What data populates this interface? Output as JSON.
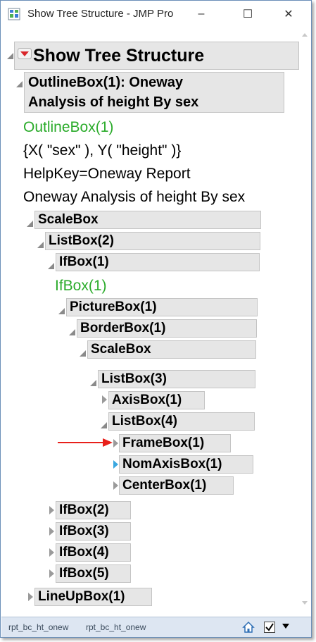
{
  "window": {
    "title": "Show Tree Structure - JMP Pro",
    "controls": {
      "minimize": "–",
      "maximize": "☐",
      "close": "✕"
    }
  },
  "root": {
    "title": "Show Tree Structure"
  },
  "outline": {
    "title_line1": "OutlineBox(1): Oneway",
    "title_line2": "Analysis of height By sex",
    "info": [
      "OutlineBox(1)",
      "{X( \"sex\" ), Y( \"height\" )}",
      "HelpKey=Oneway Report",
      "Oneway Analysis of height By sex"
    ]
  },
  "tree": {
    "scalebox1": "ScaleBox",
    "listbox2": "ListBox(2)",
    "ifbox1": "IfBox(1)",
    "ifbox1_info": "IfBox(1)",
    "picturebox1": "PictureBox(1)",
    "borderbox1": "BorderBox(1)",
    "scalebox2": "ScaleBox",
    "listbox3": "ListBox(3)",
    "axisbox1": "AxisBox(1)",
    "listbox4": "ListBox(4)",
    "framebox1": "FrameBox(1)",
    "nomaxisbox1": "NomAxisBox(1)",
    "centerbox1": "CenterBox(1)",
    "ifbox2": "IfBox(2)",
    "ifbox3": "IfBox(3)",
    "ifbox4": "IfBox(4)",
    "ifbox5": "IfBox(5)",
    "lineupbox1": "LineUpBox(1)"
  },
  "statusbar": {
    "left": "rpt_bc_ht_onew",
    "right": "rpt_bc_ht_onew"
  },
  "colors": {
    "info_green": "#2aab2a",
    "annotation_arrow": "#e8201b",
    "highlight_triangle": "#39a7e0",
    "red_menu": "#d9252a"
  }
}
